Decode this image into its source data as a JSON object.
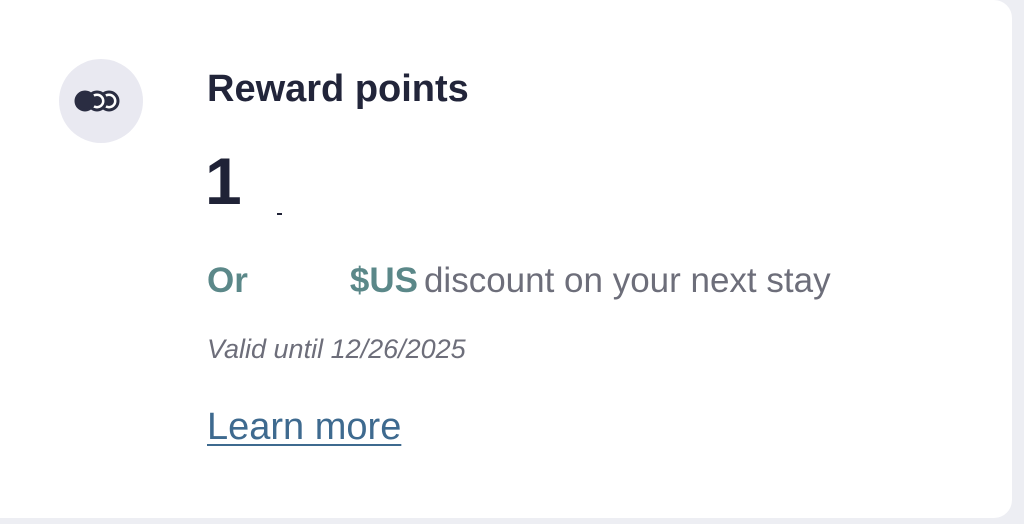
{
  "card": {
    "icon": "reward-coins-icon",
    "title": "Reward points",
    "points": "1",
    "or_label": "Or",
    "discount_amount": "",
    "currency": "$US",
    "discount_text": "discount on your next stay",
    "valid_until": "Valid until 12/26/2025",
    "learn_more": "Learn more"
  },
  "colors": {
    "title": "#22253a",
    "accent": "#5b8889",
    "muted_text": "#6d6e7a",
    "link": "#3e6a8f",
    "icon_bg": "#e9e9f1"
  }
}
